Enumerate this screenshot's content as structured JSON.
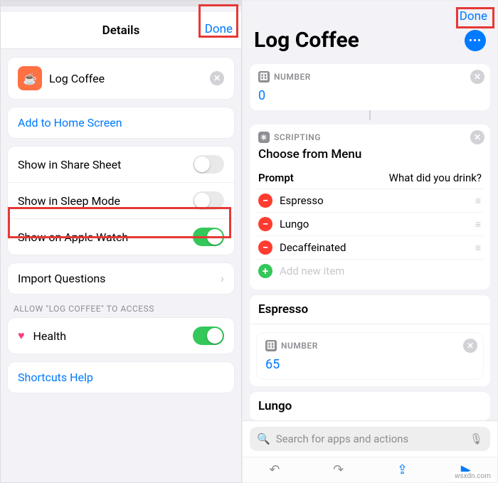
{
  "left": {
    "header": {
      "title": "Details",
      "done": "Done"
    },
    "shortcut": {
      "name": "Log Coffee"
    },
    "add_home": "Add to Home Screen",
    "settings": [
      {
        "label": "Show in Share Sheet",
        "on": false
      },
      {
        "label": "Show in Sleep Mode",
        "on": false
      },
      {
        "label": "Show on Apple Watch",
        "on": true
      }
    ],
    "import": "Import Questions",
    "access_header": "ALLOW \"LOG COFFEE\" TO ACCESS",
    "access": {
      "label": "Health",
      "on": true
    },
    "help": "Shortcuts Help"
  },
  "right": {
    "done": "Done",
    "title": "Log Coffee",
    "number1": {
      "tag": "NUMBER",
      "value": "0"
    },
    "scripting": {
      "tag": "SCRIPTING",
      "title": "Choose from Menu",
      "prompt_label": "Prompt",
      "prompt_value": "What did you drink?",
      "items": [
        "Espresso",
        "Lungo",
        "Decaffeinated"
      ],
      "add": "Add new item"
    },
    "espresso": {
      "label": "Espresso",
      "number_tag": "NUMBER",
      "value": "65"
    },
    "lungo": {
      "label": "Lungo"
    },
    "search_placeholder": "Search for apps and actions",
    "source": "wsxdn.com"
  }
}
